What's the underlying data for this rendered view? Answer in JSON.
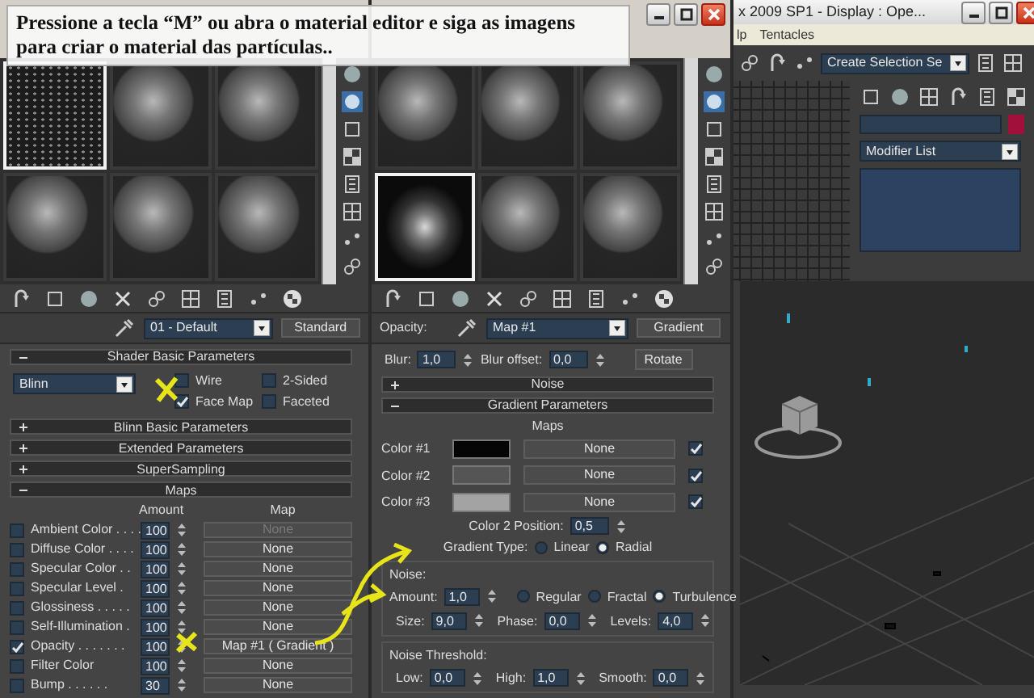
{
  "caption": "Pressione a tecla “M” ou abra o material editor e siga as imagens para criar o material das partículas..",
  "left_editor": {
    "slots": [
      {
        "kind": "particles",
        "selected": true
      },
      {
        "kind": "sphere",
        "selected": false
      },
      {
        "kind": "sphere",
        "selected": false
      },
      {
        "kind": "sphere",
        "selected": false
      },
      {
        "kind": "sphere",
        "selected": false
      },
      {
        "kind": "sphere",
        "selected": false
      }
    ],
    "material_name": "01 - Default",
    "material_type": "Standard",
    "rollouts": [
      {
        "kind": "shader",
        "title": "Shader Basic Parameters",
        "expanded": true,
        "shader": "Blinn",
        "options": [
          {
            "label": "Wire",
            "checked": false
          },
          {
            "label": "2-Sided",
            "checked": false
          },
          {
            "label": "Face Map",
            "checked": true
          },
          {
            "label": "Faceted",
            "checked": false
          }
        ]
      },
      {
        "title": "Blinn Basic Parameters",
        "expanded": false
      },
      {
        "title": "Extended Parameters",
        "expanded": false
      },
      {
        "title": "SuperSampling",
        "expanded": false
      },
      {
        "kind": "maps",
        "title": "Maps",
        "expanded": true,
        "columns": [
          "Amount",
          "Map"
        ],
        "rows": [
          {
            "label": "Ambient Color . . . .",
            "checked": false,
            "amount": "100",
            "map": "None",
            "disabled": true
          },
          {
            "label": "Diffuse Color . . . .",
            "checked": false,
            "amount": "100",
            "map": "None",
            "disabled": false
          },
          {
            "label": "Specular Color . .",
            "checked": false,
            "amount": "100",
            "map": "None",
            "disabled": false
          },
          {
            "label": "Specular Level .",
            "checked": false,
            "amount": "100",
            "map": "None",
            "disabled": false
          },
          {
            "label": "Glossiness . . . . .",
            "checked": false,
            "amount": "100",
            "map": "None",
            "disabled": false
          },
          {
            "label": "Self-Illumination .",
            "checked": false,
            "amount": "100",
            "map": "None",
            "disabled": false
          },
          {
            "label": "Opacity . . . . . . .",
            "checked": true,
            "amount": "100",
            "map": "Map #1 ( Gradient )",
            "disabled": false
          },
          {
            "label": "Filter Color",
            "checked": false,
            "amount": "100",
            "map": "None",
            "disabled": false
          },
          {
            "label": "Bump . . . . . .",
            "checked": false,
            "amount": "30",
            "map": "None",
            "disabled": false
          }
        ]
      }
    ]
  },
  "middle_editor": {
    "slots": [
      {
        "kind": "sphere",
        "selected": false
      },
      {
        "kind": "sphere",
        "selected": false
      },
      {
        "kind": "sphere",
        "selected": false
      },
      {
        "kind": "cloud",
        "selected": true
      },
      {
        "kind": "sphere",
        "selected": false
      },
      {
        "kind": "sphere",
        "selected": false
      }
    ],
    "map_slot": "Opacity:",
    "map_name": "Map #1",
    "map_type": "Gradient",
    "blur": {
      "label": "Blur:",
      "value": "1,0"
    },
    "blur_offset": {
      "label": "Blur offset:",
      "value": "0,0"
    },
    "rotate_button": "Rotate",
    "rollouts": [
      {
        "title": "Noise",
        "expanded": false
      },
      {
        "kind": "gradient",
        "title": "Gradient Parameters",
        "expanded": true,
        "maps_label": "Maps",
        "colors": [
          {
            "label": "Color #1",
            "color": "#050505",
            "map": "None",
            "checked": true
          },
          {
            "label": "Color #2",
            "color": "#555555",
            "map": "None",
            "checked": true
          },
          {
            "label": "Color #3",
            "color": "#a3a3a3",
            "map": "None",
            "checked": true
          }
        ],
        "position": {
          "label": "Color 2 Position:",
          "value": "0,5"
        },
        "gradient_type": {
          "label": "Gradient Type:",
          "options": [
            {
              "label": "Linear",
              "selected": false
            },
            {
              "label": "Radial",
              "selected": true
            }
          ]
        },
        "noise": {
          "title": "Noise:",
          "amount": {
            "label": "Amount:",
            "value": "1,0"
          },
          "types": [
            {
              "label": "Regular",
              "selected": false
            },
            {
              "label": "Fractal",
              "selected": false
            },
            {
              "label": "Turbulence",
              "selected": true
            }
          ],
          "fields": [
            {
              "label": "Size:",
              "value": "9,0"
            },
            {
              "label": "Phase:",
              "value": "0,0"
            },
            {
              "label": "Levels:",
              "value": "4,0"
            }
          ]
        },
        "threshold": {
          "title": "Noise Threshold:",
          "fields": [
            {
              "label": "Low:",
              "value": "0,0"
            },
            {
              "label": "High:",
              "value": "1,0"
            },
            {
              "label": "Smooth:",
              "value": "0,0"
            }
          ]
        }
      }
    ]
  },
  "main_window": {
    "title": "x  2009 SP1   - Display : Ope...",
    "menu": [
      "lp",
      "Tentacles"
    ],
    "selection_set": "Create Selection Se",
    "modifier_list": "Modifier List"
  }
}
